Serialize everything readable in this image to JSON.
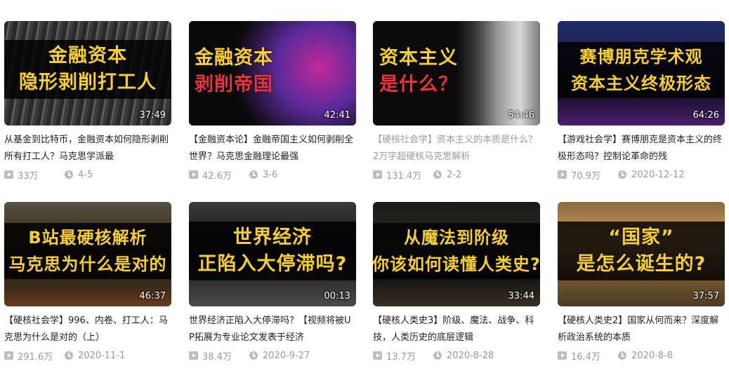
{
  "videos": [
    {
      "thumb_lines": [
        "金融资本",
        "隐形剥削打工人"
      ],
      "thumb_colors": [
        "#f7d02e",
        "#f7d02e"
      ],
      "duration": "37:49",
      "title": "从基金到比特币，金融资本如何隐形剥削所有打工人？马克思学派最",
      "plays": "33万",
      "date": "4-5",
      "visited": false
    },
    {
      "thumb_lines": [
        "金融资本",
        "剥削帝国"
      ],
      "thumb_colors": [
        "#f7d02e",
        "#e8353a"
      ],
      "duration": "42:41",
      "title": "【金融资本论】金融帝国主义如何剥削全世界？马克思金融理论最强",
      "plays": "42.6万",
      "date": "3-6",
      "visited": false
    },
    {
      "thumb_lines": [
        "资本主义",
        "是什么？"
      ],
      "thumb_colors": [
        "#f7d02e",
        "#e8353a"
      ],
      "duration": "54:46",
      "title": "【硬核社会学】资本主义的本质是什么？2万字超硬核马克思解析",
      "plays": "131.4万",
      "date": "2-2",
      "visited": true
    },
    {
      "thumb_lines": [
        "赛博朋克学术观",
        "资本主义终极形态"
      ],
      "thumb_colors": [
        "#f7d02e",
        "#f7d02e"
      ],
      "duration": "64:26",
      "title": "【游戏社会学】赛博朋克是资本主义的终极形态吗？控制论革命的残",
      "plays": "70.9万",
      "date": "2020-12-12",
      "visited": false
    },
    {
      "thumb_lines": [
        "B站最硬核解析",
        "马克思为什么是对的"
      ],
      "thumb_colors": [
        "#f7d02e",
        "#f7d02e"
      ],
      "duration": "46:37",
      "title": "【硬核社会学】996、内卷、打工人：马克思为什么是对的（上）",
      "plays": "291.6万",
      "date": "2020-11-1",
      "visited": false
    },
    {
      "thumb_lines": [
        "世界经济",
        "正陷入大停滞吗?"
      ],
      "thumb_colors": [
        "#f7d02e",
        "#f7d02e"
      ],
      "duration": "00:13",
      "title": "世界经济正陷入大停滞吗？【视频将被UP拓展为专业论文发表于经济",
      "plays": "38.4万",
      "date": "2020-9-27",
      "visited": false
    },
    {
      "thumb_lines": [
        "从魔法到阶级",
        "你该如何读懂人类史?"
      ],
      "thumb_colors": [
        "#f7d02e",
        "#f7d02e"
      ],
      "duration": "33:44",
      "title": "【硬核人类史3】阶级、魔法、战争、科技，人类历史的底层逻辑",
      "plays": "13.7万",
      "date": "2020-8-28",
      "visited": false
    },
    {
      "thumb_lines": [
        "“国家”",
        "是怎么诞生的?"
      ],
      "thumb_colors": [
        "#f7d02e",
        "#f7d02e"
      ],
      "duration": "37:57",
      "title": "【硬核人类史2】国家从何而来？深度解析政治系统的本质",
      "plays": "16.4万",
      "date": "2020-8-8",
      "visited": false
    }
  ]
}
